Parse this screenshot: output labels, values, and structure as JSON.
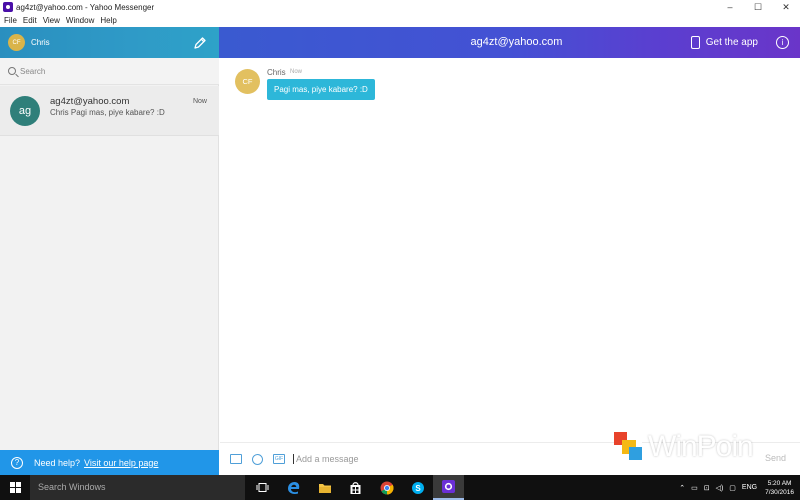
{
  "window": {
    "title": "ag4zt@yahoo.com - Yahoo Messenger",
    "menu": [
      "File",
      "Edit",
      "View",
      "Window",
      "Help"
    ],
    "controls": [
      "–",
      "☐",
      "✕"
    ]
  },
  "profile": {
    "initials": "CF",
    "name": "Chris"
  },
  "header": {
    "title": "ag4zt@yahoo.com",
    "get_app_label": "Get the app",
    "info_label": "i"
  },
  "sidebar": {
    "search_placeholder": "Search",
    "conversations": [
      {
        "initials": "ag",
        "name": "ag4zt@yahoo.com",
        "preview": "Chris Pagi mas, piye kabare? :D",
        "time": "Now"
      }
    ]
  },
  "help": {
    "text": "Need help?",
    "link": "Visit our help page",
    "icon": "?"
  },
  "chat": {
    "messages": [
      {
        "initials": "CF",
        "sender": "Chris",
        "time": "Now",
        "text": "Pagi mas, piye kabare? :D"
      }
    ]
  },
  "composer": {
    "placeholder": "Add a message",
    "send_label": "Send",
    "gif_label": "GIF"
  },
  "watermark": {
    "text": "WinPoin"
  },
  "taskbar": {
    "search_placeholder": "Search Windows",
    "language": "ENG",
    "time": "5:20 AM",
    "date": "7/30/2016"
  },
  "colors": {
    "accent_blue": "#2196e8",
    "bubble": "#2db7d9",
    "header_purple": "#5a3fd0",
    "avatar_green": "#2f7f7a",
    "avatar_gold": "#e2c060"
  }
}
